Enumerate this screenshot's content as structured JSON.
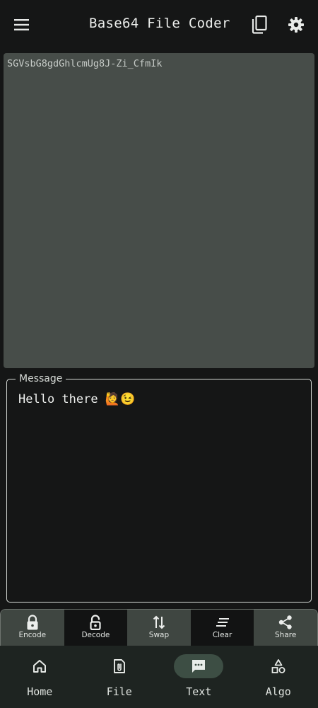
{
  "app": {
    "title": "Base64 File Coder",
    "icons": {
      "menu": "menu-icon",
      "copy": "copy-icon",
      "settings": "settings-icon"
    }
  },
  "output": {
    "value": "SGVsbG8gdGhlcmUg8J-Zi_CfmIk"
  },
  "message": {
    "label": "Message",
    "value": "Hello there 🙋😉"
  },
  "actions": [
    {
      "label": "Encode",
      "icon": "lock-icon"
    },
    {
      "label": "Decode",
      "icon": "unlock-icon"
    },
    {
      "label": "Swap",
      "icon": "swap-vertical-icon"
    },
    {
      "label": "Clear",
      "icon": "clear-lines-icon"
    },
    {
      "label": "Share",
      "icon": "share-icon"
    }
  ],
  "nav": {
    "active": "Text",
    "items": [
      {
        "label": "Home",
        "icon": "home-icon"
      },
      {
        "label": "File",
        "icon": "file-attachment-icon"
      },
      {
        "label": "Text",
        "icon": "message-icon"
      },
      {
        "label": "Algo",
        "icon": "shapes-icon"
      }
    ]
  },
  "colors": {
    "background": "#151616",
    "output_box": "#474d49",
    "nav_background": "#1e2421",
    "nav_active_pill": "#3d4e44",
    "action_light": "#3f4641",
    "action_dark": "#121313"
  }
}
